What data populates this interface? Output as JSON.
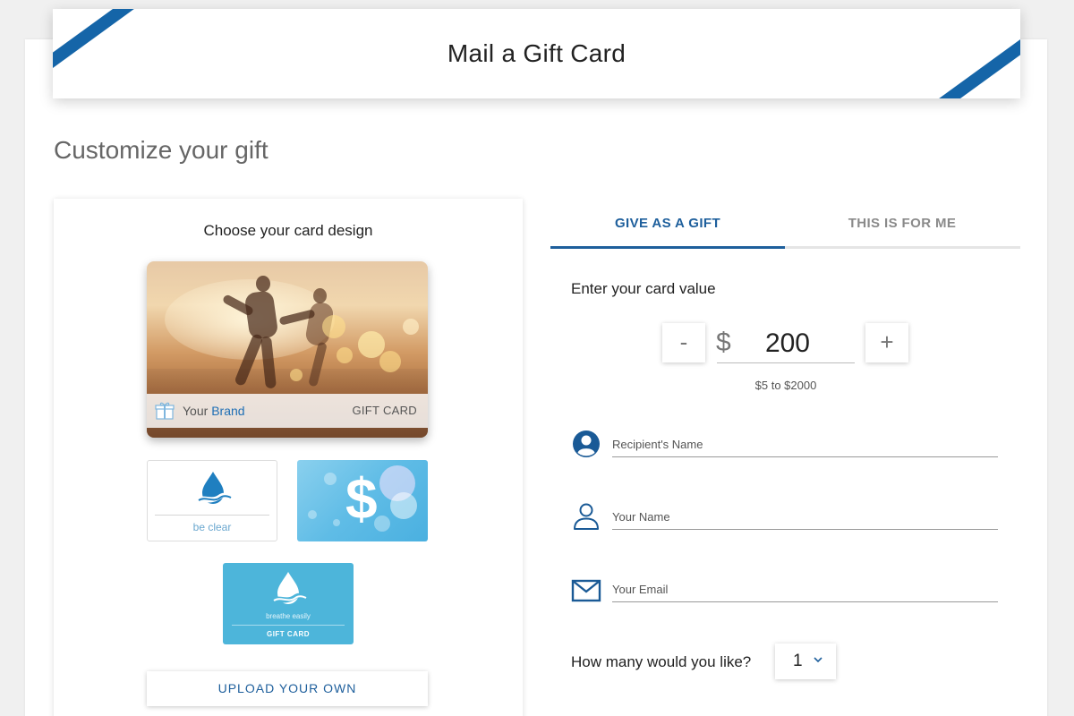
{
  "header": {
    "title": "Mail a Gift Card"
  },
  "page": {
    "section_title": "Customize your gift"
  },
  "design": {
    "heading": "Choose your card design",
    "main_card": {
      "brand_prefix": "Your",
      "brand_word": "Brand",
      "label": "GIFT CARD"
    },
    "thumbnails": [
      {
        "name": "be-clear",
        "label": "be clear"
      },
      {
        "name": "dollar-bubbles",
        "label": "$"
      },
      {
        "name": "breathe-easily",
        "label": "breathe easily",
        "sublabel": "GIFT CARD"
      }
    ],
    "upload_label": "UPLOAD YOUR OWN"
  },
  "tabs": [
    {
      "label": "GIVE AS A GIFT",
      "active": true
    },
    {
      "label": "THIS IS FOR ME",
      "active": false
    }
  ],
  "value": {
    "heading": "Enter your card value",
    "minus_label": "-",
    "plus_label": "+",
    "currency": "$",
    "amount": "200",
    "range": "$5 to $2000"
  },
  "fields": {
    "recipient": {
      "placeholder": "Recipient's Name",
      "icon": "user-filled-icon"
    },
    "your_name": {
      "placeholder": "Your Name",
      "icon": "user-outline-icon"
    },
    "your_email": {
      "placeholder": "Your Email",
      "icon": "envelope-icon"
    }
  },
  "quantity": {
    "label": "How many would you like?",
    "value": "1"
  },
  "colors": {
    "accent": "#1e5f9c",
    "ribbon": "#1565a8",
    "thumb_blue": "#4db5da"
  }
}
